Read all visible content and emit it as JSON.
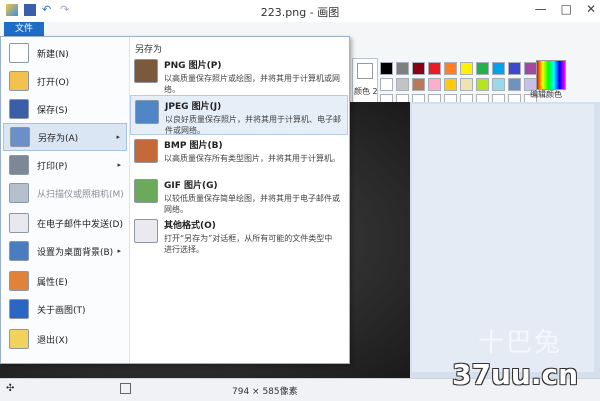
{
  "window": {
    "title": "223.png - 画图",
    "minimize": "—",
    "maximize": "□",
    "close": "✕"
  },
  "file_tab": "文件",
  "file_menu": {
    "items": [
      {
        "label": "新建(N)",
        "icon": "new-icon"
      },
      {
        "label": "打开(O)",
        "icon": "open-icon"
      },
      {
        "label": "保存(S)",
        "icon": "save-icon"
      },
      {
        "label": "另存为(A)",
        "icon": "save-as-icon",
        "submenu": "▸"
      },
      {
        "label": "打印(P)",
        "icon": "print-icon",
        "submenu": "▸"
      },
      {
        "label": "从扫描仪或照相机(M)",
        "icon": "scanner-icon",
        "disabled": true
      },
      {
        "label": "在电子邮件中发送(D)",
        "icon": "email-icon"
      },
      {
        "label": "设置为桌面背景(B)",
        "icon": "desktop-icon",
        "submenu": "▸"
      },
      {
        "label": "属性(E)",
        "icon": "properties-icon"
      },
      {
        "label": "关于画图(T)",
        "icon": "about-icon"
      },
      {
        "label": "退出(X)",
        "icon": "exit-icon"
      }
    ],
    "save_as": {
      "title": "另存为",
      "options": [
        {
          "title": "PNG 图片(P)",
          "desc": "以高质量保存照片或绘图，并将其用于计算机或网络。",
          "icon": "png-icon"
        },
        {
          "title": "JPEG 图片(J)",
          "desc": "以良好质量保存照片，并将其用于计算机、电子邮件或网络。",
          "icon": "jpeg-icon"
        },
        {
          "title": "BMP 图片(B)",
          "desc": "以高质量保存所有类型图片，并将其用于计算机。",
          "icon": "bmp-icon"
        },
        {
          "title": "GIF 图片(G)",
          "desc": "以较低质量保存简单绘图，并将其用于电子邮件或网络。",
          "icon": "gif-icon"
        },
        {
          "title": "其他格式(O)",
          "desc": "打开“另存为”对话框，从所有可能的文件类型中进行选择。",
          "icon": "other-formats-icon"
        }
      ]
    }
  },
  "ribbon": {
    "color2_label": "颜色 2",
    "edit_colors_label": "编辑颜色",
    "group_label": "颜色",
    "palette": [
      "#000000",
      "#7f7f7f",
      "#880015",
      "#ed1c24",
      "#ff7f27",
      "#fff200",
      "#22b14c",
      "#00a2e8",
      "#3f48cc",
      "#a349a4",
      "#ffffff",
      "#c3c3c3",
      "#b97a57",
      "#ffaec9",
      "#ffc90e",
      "#efe4b0",
      "#b5e61d",
      "#99d9ea",
      "#7092be",
      "#c8bfe7",
      "#ffffff",
      "#ffffff",
      "#ffffff",
      "#ffffff",
      "#ffffff",
      "#ffffff",
      "#ffffff",
      "#ffffff",
      "#ffffff",
      "#ffffff"
    ]
  },
  "status": {
    "dimensions": "794 × 585像素"
  },
  "watermark": {
    "text": "37uu.cn",
    "cn": "十巴兔"
  },
  "colors": {
    "accent": "#1e6cc8",
    "hover": "#dbe6f4"
  }
}
